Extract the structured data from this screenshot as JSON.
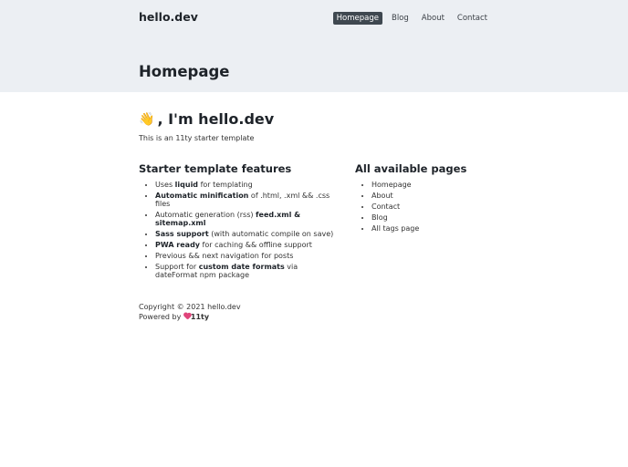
{
  "header": {
    "brand": "hello.dev",
    "nav": [
      {
        "label": "Homepage",
        "active": true
      },
      {
        "label": "Blog"
      },
      {
        "label": "About"
      },
      {
        "label": "Contact"
      }
    ],
    "page_title": "Homepage"
  },
  "intro": {
    "greeting_emoji": "👋",
    "heading": ", I'm hello.dev",
    "tagline": "This is an 11ty starter template"
  },
  "features": {
    "title": "Starter template features",
    "items": [
      {
        "pre": "Uses ",
        "bold": "liquid",
        "post": " for templating"
      },
      {
        "pre": "",
        "bold": "Automatic minification",
        "post": " of .html, .xml && .css files"
      },
      {
        "pre": "Automatic generation (rss) ",
        "bold": "feed.xml & sitemap.xml",
        "post": ""
      },
      {
        "pre": "",
        "bold": "Sass support",
        "post": " (with automatic compile on save)"
      },
      {
        "pre": "",
        "bold": "PWA ready",
        "post": " for caching && offline support"
      },
      {
        "pre": "Previous && next navigation for posts",
        "bold": "",
        "post": ""
      },
      {
        "pre": "Support for ",
        "bold": "custom date formats",
        "post": " via dateFormat npm package"
      }
    ]
  },
  "pages": {
    "title": "All available pages",
    "items": [
      "Homepage",
      "About",
      "Contact",
      "Blog",
      "All tags page"
    ]
  },
  "footer": {
    "copyright": "Copyright © 2021 hello.dev",
    "powered_by": "Powered by ",
    "powered_name": "11ty",
    "heart_color": "#e0457b"
  }
}
